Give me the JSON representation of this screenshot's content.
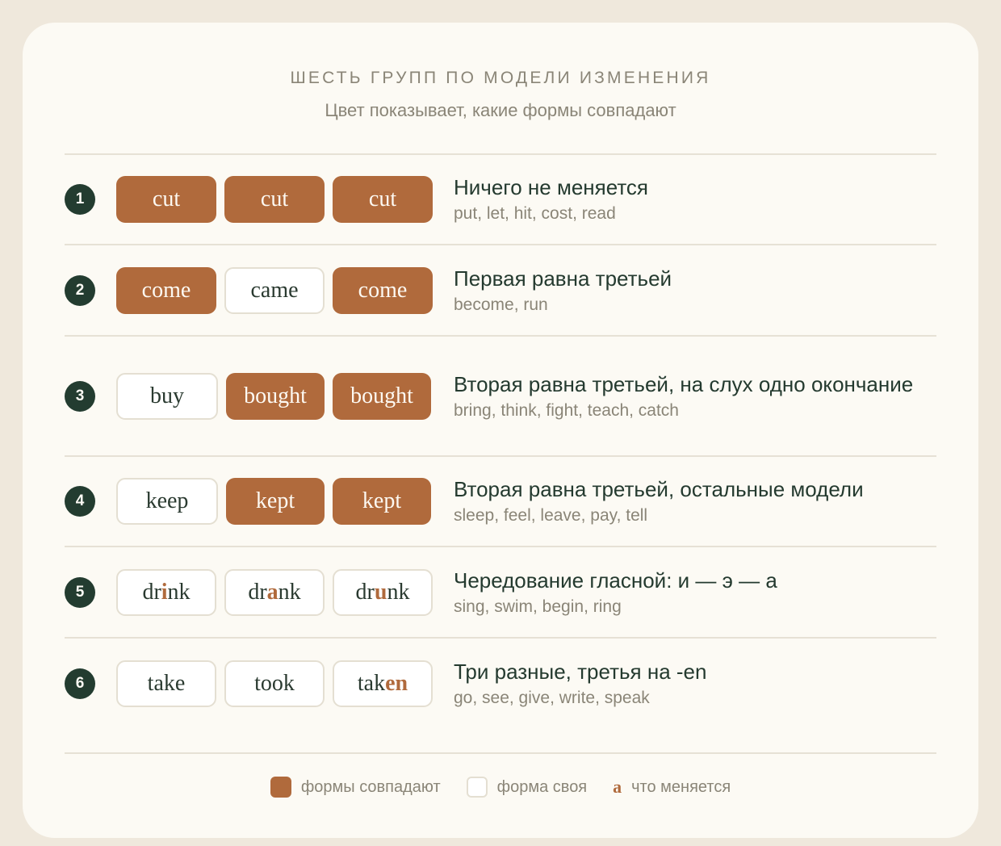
{
  "header": {
    "title": "ШЕСТЬ ГРУПП ПО МОДЕЛИ ИЗМЕНЕНИЯ",
    "subtitle": "Цвет показывает, какие формы совпадают"
  },
  "groups": [
    {
      "number": "1",
      "forms": [
        {
          "text": "cut",
          "type": "same"
        },
        {
          "text": "cut",
          "type": "same"
        },
        {
          "text": "cut",
          "type": "same"
        }
      ],
      "title": "Ничего не меняется",
      "examples": "put, let, hit, cost, read"
    },
    {
      "number": "2",
      "forms": [
        {
          "text": "come",
          "type": "same"
        },
        {
          "text": "came",
          "type": "own"
        },
        {
          "text": "come",
          "type": "same"
        }
      ],
      "title": "Первая равна третьей",
      "examples": "become, run"
    },
    {
      "number": "3",
      "forms": [
        {
          "text": "buy",
          "type": "own"
        },
        {
          "text": "bought",
          "type": "same"
        },
        {
          "text": "bought",
          "type": "same"
        }
      ],
      "title": "Вторая равна третьей, на слух одно окончание",
      "examples": "bring, think, fight, teach, catch"
    },
    {
      "number": "4",
      "forms": [
        {
          "text": "keep",
          "type": "own"
        },
        {
          "text": "kept",
          "type": "same"
        },
        {
          "text": "kept",
          "type": "same"
        }
      ],
      "title": "Вторая равна третьей, остальные модели",
      "examples": "sleep, feel, leave, pay, tell"
    },
    {
      "number": "5",
      "forms": [
        {
          "pre": "dr",
          "hl": "i",
          "post": "nk",
          "type": "own"
        },
        {
          "pre": "dr",
          "hl": "a",
          "post": "nk",
          "type": "own"
        },
        {
          "pre": "dr",
          "hl": "u",
          "post": "nk",
          "type": "own"
        }
      ],
      "title": "Чередование гласной: и — э — а",
      "examples": "sing, swim, begin, ring"
    },
    {
      "number": "6",
      "forms": [
        {
          "text": "take",
          "type": "own"
        },
        {
          "text": "took",
          "type": "own"
        },
        {
          "pre": "tak",
          "hl": "en",
          "post": "",
          "type": "own"
        }
      ],
      "title": "Три разные, третья на -en",
      "examples": "go, see, give, write, speak"
    }
  ],
  "legend": {
    "same_label": "формы совпадают",
    "own_label": "форма своя",
    "change_letter": "a",
    "change_label": "что меняется"
  },
  "colors": {
    "same_fill": "#b06a3c",
    "badge": "#233c30",
    "card": "#fcfaf4",
    "page": "#efe8dc"
  }
}
